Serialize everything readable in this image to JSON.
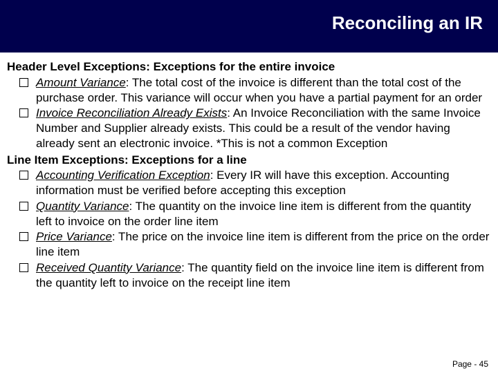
{
  "title": "Reconciling an IR",
  "section1": {
    "heading": "Header Level Exceptions: Exceptions for the entire invoice",
    "items": [
      {
        "term": "Amount Variance",
        "desc": ": The total cost of the invoice is different than the total cost of the purchase order.  This variance will occur when you have a partial payment for an order"
      },
      {
        "term": "Invoice Reconciliation Already Exists",
        "desc": ":  An Invoice Reconciliation with the same Invoice Number and Supplier already exists. This could be a result of the vendor having already sent an electronic invoice. *This is not a common Exception"
      }
    ]
  },
  "section2": {
    "heading": "Line Item Exceptions: Exceptions for a line",
    "items": [
      {
        "term": "Accounting Verification Exception",
        "desc": ": Every IR will have this exception. Accounting information must be verified before accepting this exception"
      },
      {
        "term": "Quantity Variance",
        "desc": ": The quantity on the invoice line item is different from the quantity left to invoice on the order line item"
      },
      {
        "term": "Price Variance",
        "desc": ": The price on the invoice line item is different from the price on the order line item"
      },
      {
        "term": "Received Quantity Variance",
        "desc": ": The quantity field on the invoice line item is different from the quantity left to invoice on the receipt line item"
      }
    ]
  },
  "footer": "Page -  45"
}
